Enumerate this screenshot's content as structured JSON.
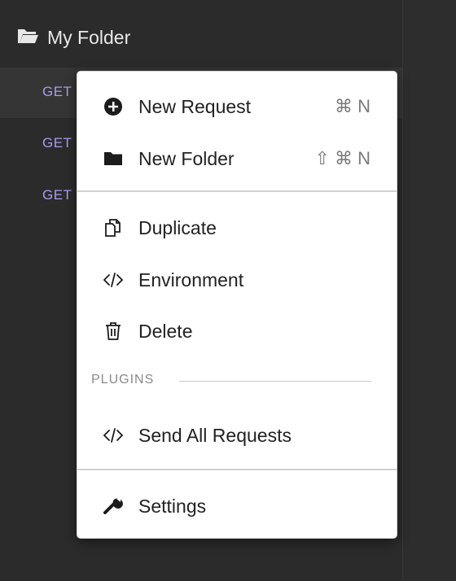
{
  "sidebar": {
    "folder": {
      "icon": "folder-open-icon",
      "name": "My Folder"
    },
    "requests": [
      {
        "method": "GET"
      },
      {
        "method": "GET"
      },
      {
        "method": "GET"
      }
    ]
  },
  "menu": {
    "items": [
      {
        "icon": "plus-circle-icon",
        "label": "New Request",
        "shortcut": "⌘ N"
      },
      {
        "icon": "folder-icon",
        "label": "New Folder",
        "shortcut": "⇧ ⌘ N"
      },
      {
        "icon": "duplicate-icon",
        "label": "Duplicate"
      },
      {
        "icon": "code-icon",
        "label": "Environment"
      },
      {
        "icon": "trash-icon",
        "label": "Delete"
      }
    ],
    "plugins_header": "PLUGINS",
    "plugin_items": [
      {
        "icon": "code-icon",
        "label": "Send All Requests"
      }
    ],
    "settings": {
      "icon": "wrench-icon",
      "label": "Settings"
    }
  },
  "colors": {
    "method_get": "#a89bf0",
    "sidebar_bg": "#2b2b2b",
    "menu_bg": "#ffffff"
  }
}
